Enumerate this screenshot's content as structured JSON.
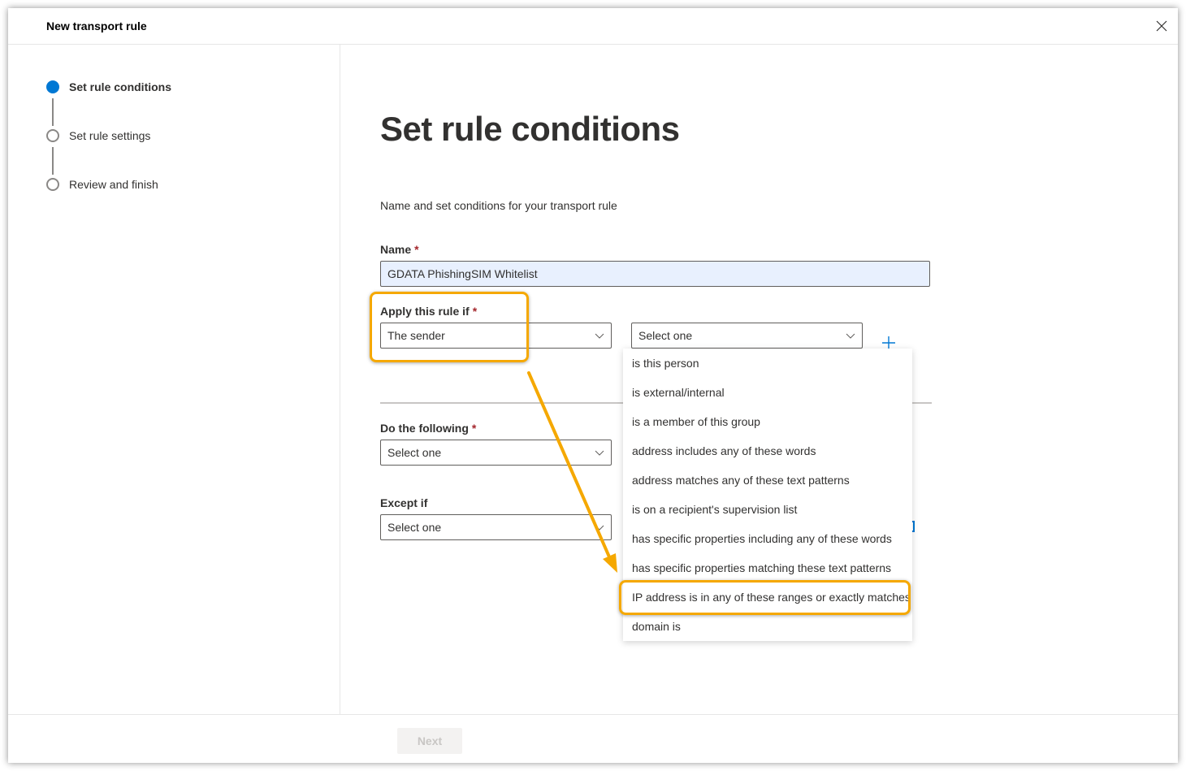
{
  "header": {
    "title": "New transport rule",
    "close_icon": "close-icon"
  },
  "steps": [
    {
      "label": "Set rule conditions",
      "state": "active"
    },
    {
      "label": "Set rule settings",
      "state": "pending"
    },
    {
      "label": "Review and finish",
      "state": "pending"
    }
  ],
  "main": {
    "title": "Set rule conditions",
    "subtitle": "Name and set conditions for your transport rule",
    "name": {
      "label": "Name",
      "required_mark": "*",
      "value": "GDATA PhishingSIM Whitelist"
    },
    "apply_rule": {
      "label": "Apply this rule if",
      "required_mark": "*",
      "first_select": "The sender",
      "second_select": "Select one",
      "add_icon": "plus-icon"
    },
    "do_following": {
      "label": "Do the following",
      "required_mark": "*",
      "select": "Select one"
    },
    "except_if": {
      "label": "Except if",
      "select": "Select one"
    }
  },
  "dropdown_menu": {
    "items": [
      "is this person",
      "is external/internal",
      "is a member of this group",
      "address includes any of these words",
      "address matches any of these text patterns",
      "is on a recipient's supervision list",
      "has specific properties including any of these words",
      "has specific properties matching these text patterns",
      "IP address is in any of these ranges or exactly matches",
      "domain is"
    ],
    "highlighted_index": 8
  },
  "footer": {
    "next_label": "Next",
    "next_enabled": false
  },
  "colors": {
    "accent": "#0078d4",
    "highlight": "#f5a800",
    "required": "#a4262c",
    "input_autofill": "#e8f0fe"
  }
}
